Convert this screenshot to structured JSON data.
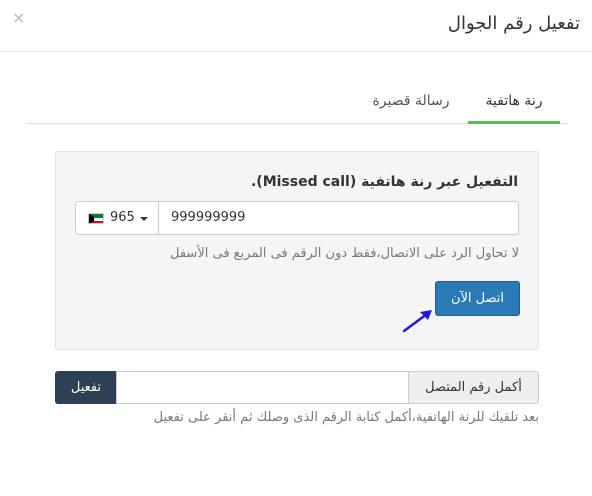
{
  "modal": {
    "title": "تفعيل رقم الجوال",
    "close_glyph": "×"
  },
  "tabs": [
    {
      "label": "رنة هاتفية",
      "active": true
    },
    {
      "label": "رسالة قصيرة",
      "active": false
    }
  ],
  "call_panel": {
    "title": "التفعيل عبر رنة هاتفية (Missed call).",
    "country_code": "965",
    "country_flag": "kuwait-flag-icon",
    "phone_value": "999999999",
    "help": "لا تحاول الرد على الاتصال،فقط دون الرقم فى المربع فى الأسفل",
    "call_button": "اتصل الآن",
    "accent": "#2a7ab6",
    "tab_active_color": "#5cb85c"
  },
  "activation": {
    "button": "تفعيل",
    "input_value": "",
    "addon": "أكمل رقم المتصل",
    "help": "بعد تلقيك للرنة الهاتفية،أكمل كتابة الرقم الذى وصلك ثم أنقر على تفعيل"
  }
}
